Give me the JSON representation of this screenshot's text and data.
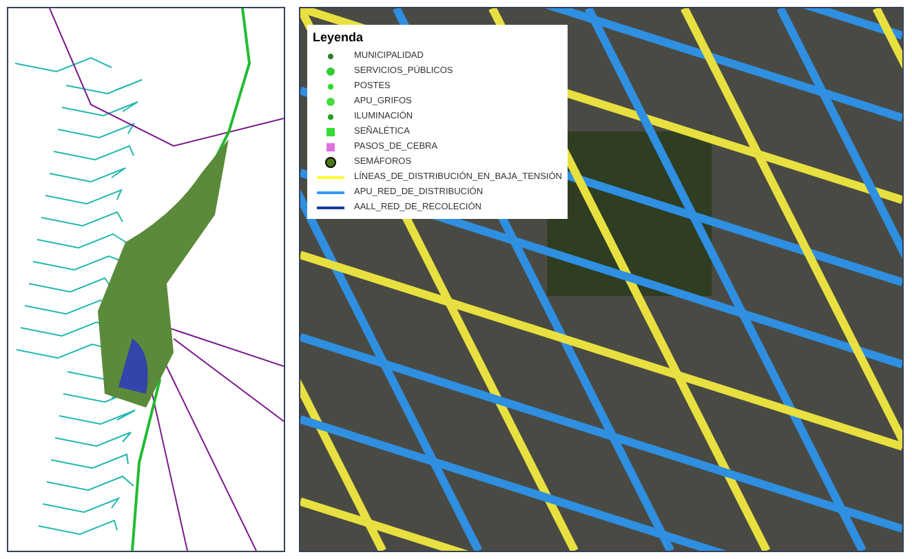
{
  "legend": {
    "title": "Leyenda",
    "items": [
      {
        "kind": "dot",
        "color": "#2e7d32",
        "label": "MUNICIPALIDAD"
      },
      {
        "kind": "bigdot",
        "color": "#33cc33",
        "label": "SERVICIOS_PÚBLICOS"
      },
      {
        "kind": "dot",
        "color": "#22dd22",
        "label": "POSTES"
      },
      {
        "kind": "bigdot",
        "color": "#44dd44",
        "label": "APU_GRIFOS"
      },
      {
        "kind": "dot",
        "color": "#1fa31f",
        "label": "ILUMINACIÓN"
      },
      {
        "kind": "square",
        "color": "#33dd33",
        "label": "SEÑALÉTICA"
      },
      {
        "kind": "square",
        "color": "#e070e0",
        "label": "PASOS_DE_CEBRA"
      },
      {
        "kind": "ring",
        "color": "#4a7a10",
        "label": "SEMÁFOROS"
      },
      {
        "kind": "line",
        "color": "#ffff33",
        "label": "LÍNEAS_DE_DISTRIBUCIÓN_EN_BAJA_TENSIÓN"
      },
      {
        "kind": "line",
        "color": "#3399ff",
        "label": "APU_RED_DE_DISTRIBUCIÓN"
      },
      {
        "kind": "line",
        "color": "#1a3a99",
        "label": "AALL_RED_DE_RECOLECIÓN"
      }
    ]
  }
}
